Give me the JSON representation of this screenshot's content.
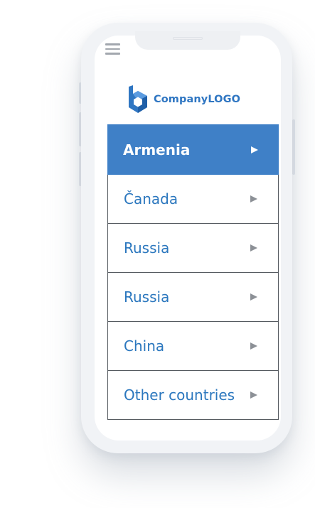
{
  "logo": {
    "text": "CompanyLOGO"
  },
  "menu": {
    "items": [
      {
        "label": "Armenia",
        "active": true
      },
      {
        "label": "Čanada",
        "active": false
      },
      {
        "label": "Russia",
        "active": false
      },
      {
        "label": "Russia",
        "active": false
      },
      {
        "label": "China",
        "active": false
      },
      {
        "label": "Other countries",
        "active": false
      }
    ]
  },
  "colors": {
    "accent": "#3f80c7",
    "link_text": "#2b77be",
    "logo_text": "#2f76c2",
    "arrow": "#8c9096",
    "border": "#555a60"
  },
  "icons": {
    "menu": "hamburger-icon",
    "logo": "logo-b-icon",
    "item_arrow": "triangle-right-icon"
  }
}
